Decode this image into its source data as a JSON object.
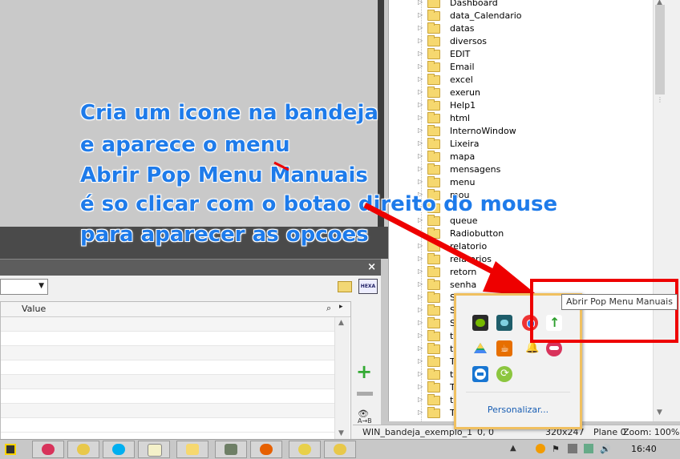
{
  "annotation": {
    "lines": [
      "Cria um icone na bandeja",
      "e aparece o menu",
      "Abrir Pop Menu Manuais",
      "é so clicar com o botao direito do mouse",
      "para aparecer as opcoes"
    ],
    "color": "#1e7bea",
    "arrow_color": "#ee0000"
  },
  "properties_panel": {
    "close_label": "×",
    "column_value": "Value",
    "hexa_label": "HEXA",
    "sort_label": "A→B"
  },
  "tree": {
    "items": [
      "Dashboard",
      "data_Calendario",
      "datas",
      "diversos",
      "EDIT",
      "Email",
      "excel",
      "exerun",
      "Help1",
      "html",
      "InternoWindow",
      "Lixeira",
      "mapa",
      "mensagens",
      "menu",
      "mou",
      "",
      "queue",
      "Radiobutton",
      "relatorio",
      "relatorios",
      "retorn",
      "senha",
      "S",
      "S",
      "S",
      "t",
      "t",
      "T",
      "t",
      "T",
      "t",
      "T"
    ]
  },
  "status_bar": {
    "file": "WIN_bandeja_exemplo_1",
    "coords": "0, 0",
    "size": "320x247",
    "plane": "Plane 0",
    "zoom": "Zoom: 100%"
  },
  "tray_popup": {
    "personalize_label": "Personalizar...",
    "tooltip": "Abrir Pop Menu Manuais",
    "icons": [
      "nvidia-icon",
      "display-icon",
      "chrome-icon",
      "app-arrow-icon",
      "google-drive-icon",
      "java-icon",
      "notification-bell-icon",
      "windev-lips-icon",
      "teamviewer-icon",
      "sync-icon"
    ]
  },
  "taskbar": {
    "clock": "16:40",
    "buttons": [
      "start-icon",
      "lips-app-icon",
      "windev-icon",
      "skype-icon",
      "notepad-icon",
      "file-explorer-icon",
      "vmware-icon",
      "firefox-icon",
      "winrar-icon",
      "windev-wx-icon"
    ]
  }
}
